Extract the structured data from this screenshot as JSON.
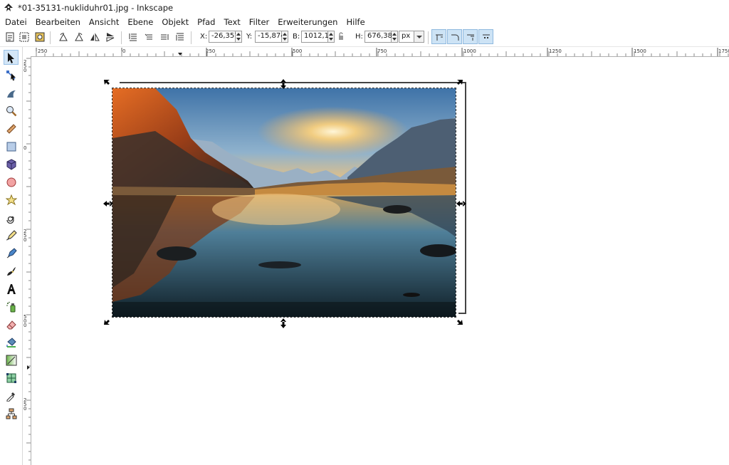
{
  "window": {
    "title": "*01-35131-nukliduhr01.jpg - Inkscape",
    "app_icon": "inkscape-icon"
  },
  "menu": [
    {
      "label": "Datei"
    },
    {
      "label": "Bearbeiten"
    },
    {
      "label": "Ansicht"
    },
    {
      "label": "Ebene"
    },
    {
      "label": "Objekt"
    },
    {
      "label": "Pfad"
    },
    {
      "label": "Text"
    },
    {
      "label": "Filter"
    },
    {
      "label": "Erweiterungen"
    },
    {
      "label": "Hilfe"
    }
  ],
  "toolbar": {
    "x_label": "X:",
    "x_value": "-26,357",
    "y_label": "Y:",
    "y_value": "-15,874",
    "w_label": "B:",
    "w_value": "1012,11",
    "h_label": "H:",
    "h_value": "676,389",
    "unit": "px"
  },
  "ruler": {
    "h_labels": [
      "250",
      "0",
      "250",
      "500",
      "750",
      "1000",
      "1250",
      "1500",
      "1750"
    ],
    "v_labels": [
      "2\n5\n0",
      "0",
      "2\n5\n0",
      "5\n0\n0",
      "7\n5\n0",
      "1\n0\n0\n0",
      "2\n5\n0"
    ]
  },
  "tools": [
    "selector-tool-icon",
    "node-tool-icon",
    "tweak-tool-icon",
    "zoom-tool-icon",
    "measure-tool-icon",
    "rectangle-tool-icon",
    "box3d-tool-icon",
    "ellipse-tool-icon",
    "star-tool-icon",
    "spiral-tool-icon",
    "pencil-tool-icon",
    "pen-tool-icon",
    "calligraphy-tool-icon",
    "text-tool-icon",
    "spray-tool-icon",
    "eraser-tool-icon",
    "paint-bucket-icon",
    "gradient-tool-icon",
    "mesh-tool-icon",
    "dropper-tool-icon",
    "connector-tool-icon"
  ],
  "colors": {
    "selection": "#cde3f5",
    "accent": "#3c8ccf"
  }
}
